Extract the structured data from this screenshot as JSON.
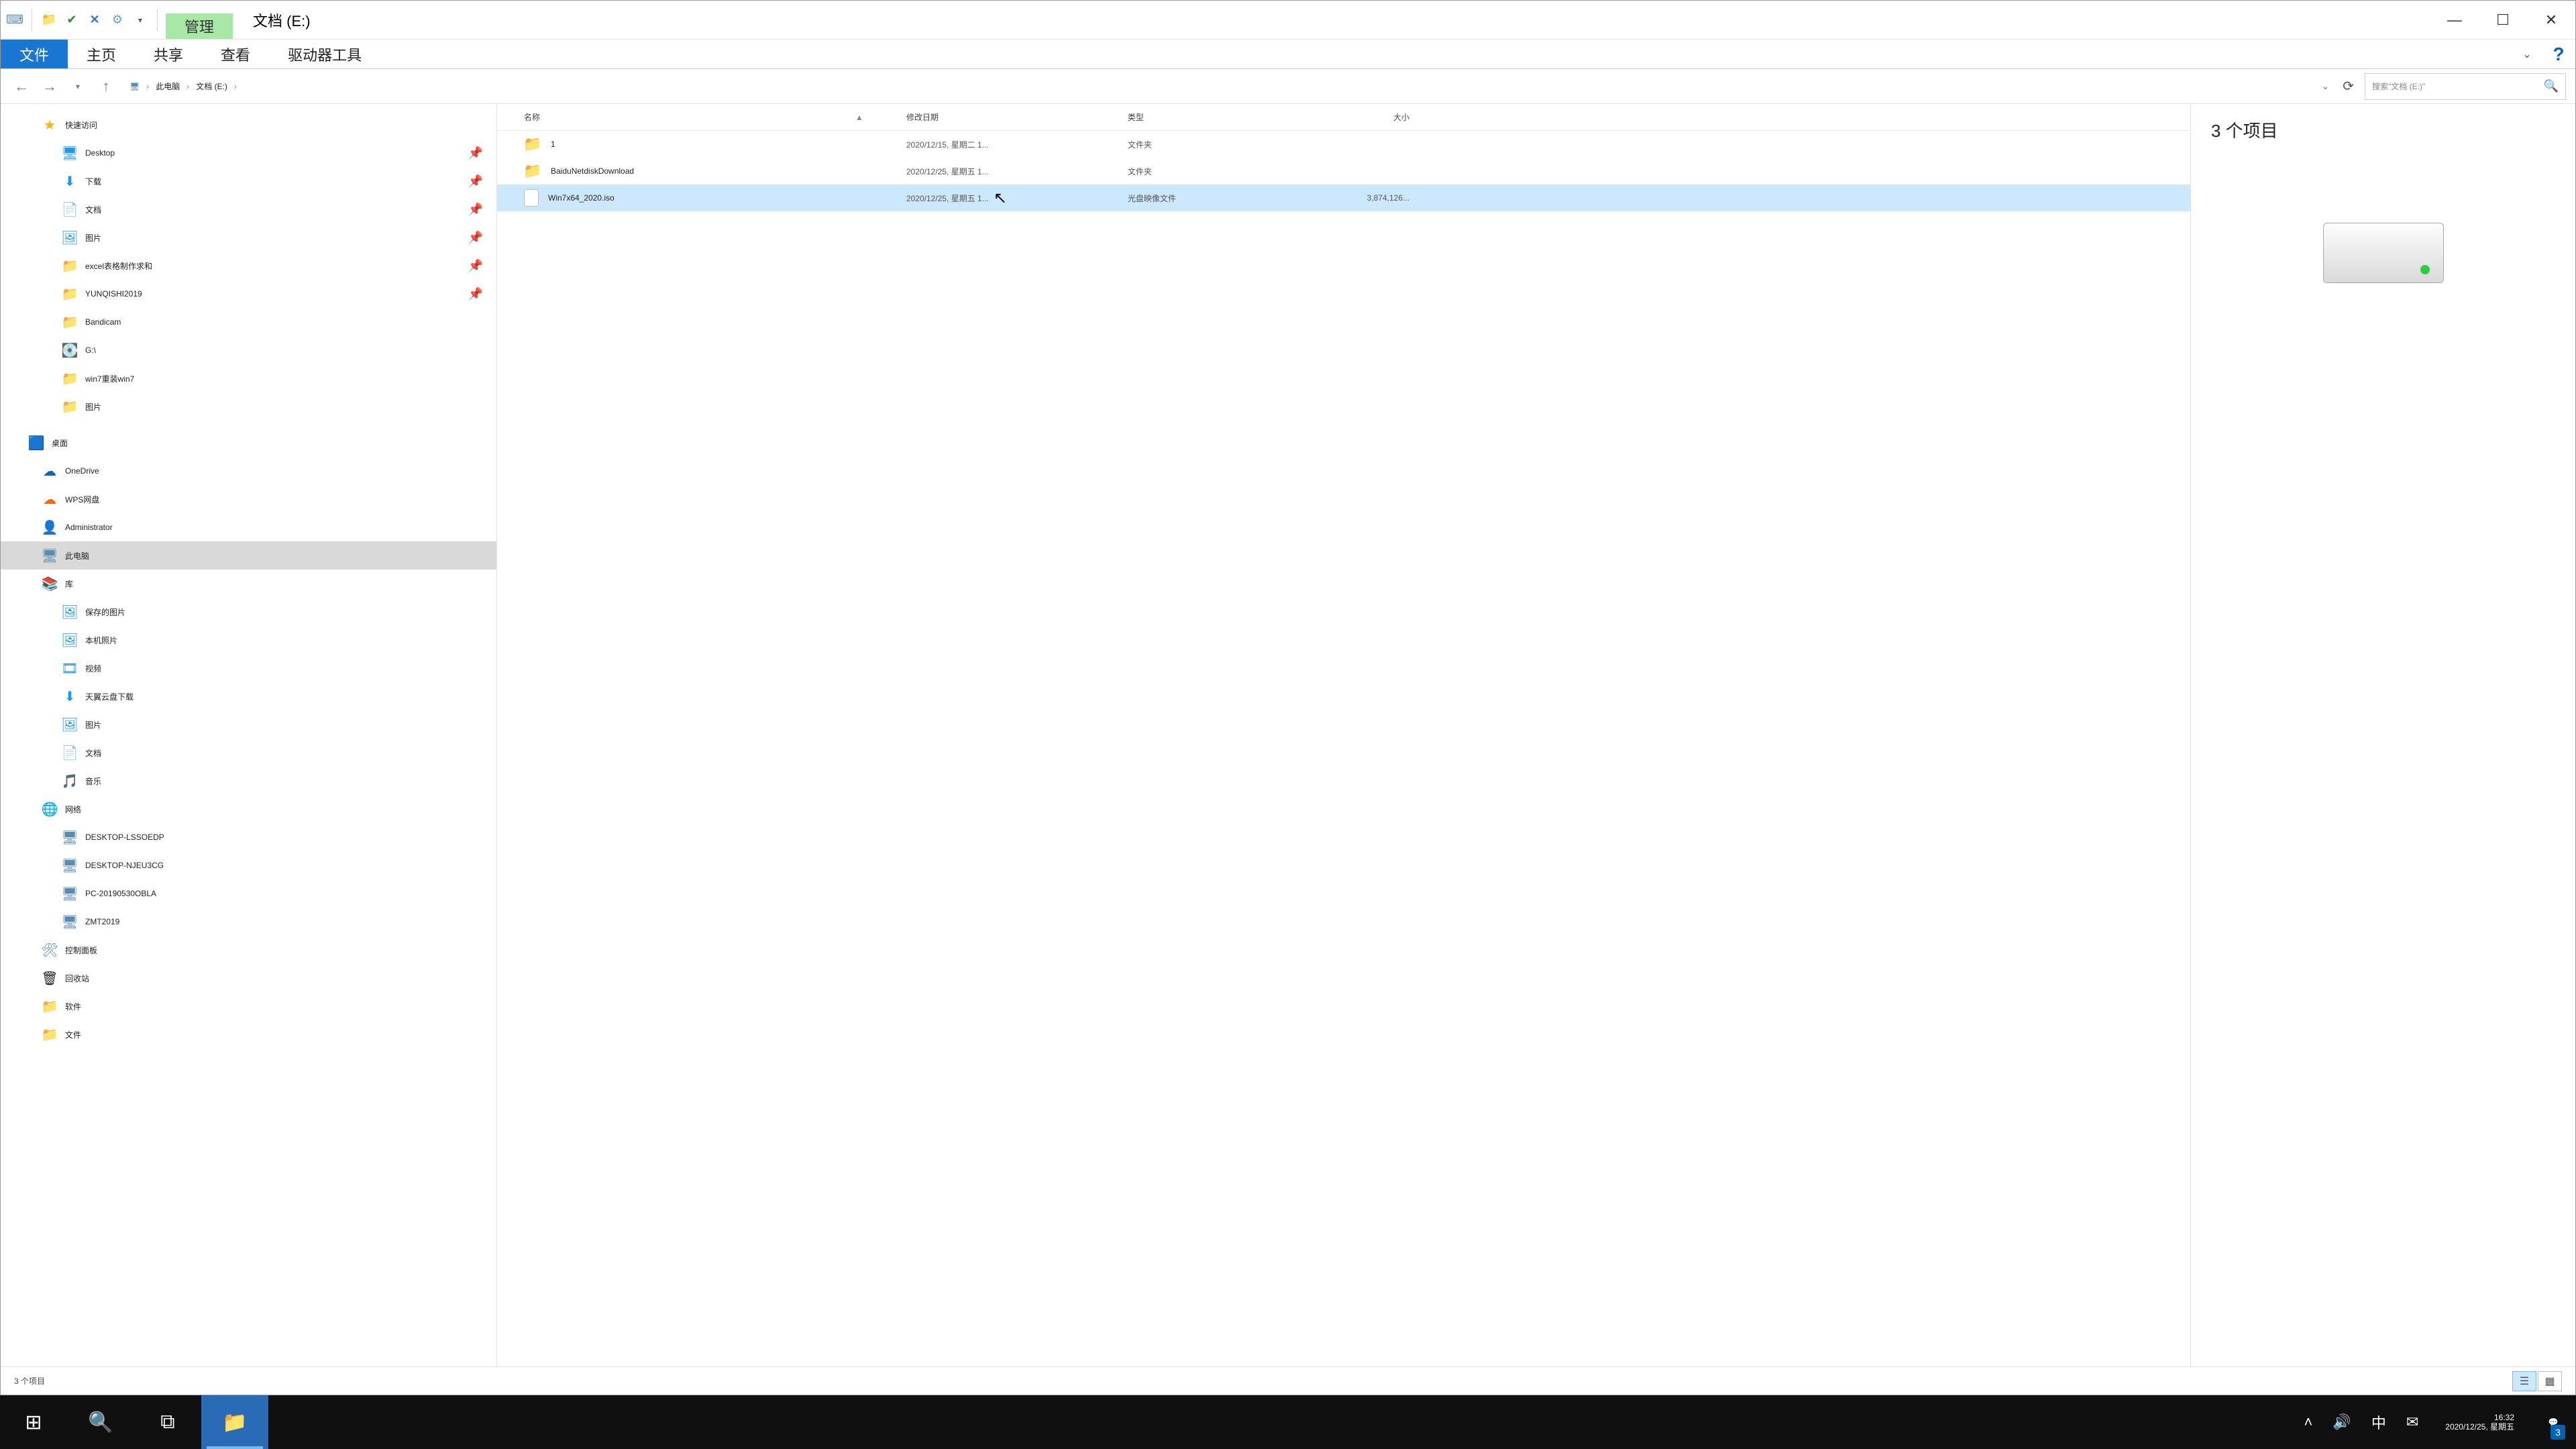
{
  "title": {
    "context_tab": "管理",
    "location": "文档 (E:)"
  },
  "ribbon": {
    "file": "文件",
    "home": "主页",
    "share": "共享",
    "view": "查看",
    "drive_tools": "驱动器工具"
  },
  "nav": {
    "back": "←",
    "forward": "→",
    "up": "↑"
  },
  "breadcrumb": {
    "root": "此电脑",
    "current": "文档 (E:)"
  },
  "search": {
    "placeholder": "搜索\"文档 (E:)\""
  },
  "tree": {
    "quick_access": "快速访问",
    "desktop": "Desktop",
    "downloads": "下载",
    "documents": "文档",
    "pictures": "图片",
    "excel": "excel表格制作求和",
    "yunqishi": "YUNQISHI2019",
    "bandicam": "Bandicam",
    "gdrive": "G:\\",
    "win7reinstall": "win7重装win7",
    "pictures2": "图片",
    "desktop_group": "桌面",
    "onedrive": "OneDrive",
    "wps": "WPS网盘",
    "admin": "Administrator",
    "this_pc": "此电脑",
    "libraries": "库",
    "saved_pics": "保存的图片",
    "camera_roll": "本机照片",
    "videos": "视频",
    "tianyi": "天翼云盘下载",
    "lib_pictures": "图片",
    "lib_documents": "文档",
    "music": "音乐",
    "network": "网络",
    "d1": "DESKTOP-LSSOEDP",
    "d2": "DESKTOP-NJEU3CG",
    "d3": "PC-20190530OBLA",
    "d4": "ZMT2019",
    "control_panel": "控制面板",
    "recycle": "回收站",
    "software": "软件",
    "files": "文件"
  },
  "columns": {
    "name": "名称",
    "date": "修改日期",
    "type": "类型",
    "size": "大小"
  },
  "rows": [
    {
      "name": "1",
      "date": "2020/12/15, 星期二 1...",
      "type": "文件夹",
      "size": "",
      "icon": "folder",
      "selected": false
    },
    {
      "name": "BaiduNetdiskDownload",
      "date": "2020/12/25, 星期五 1...",
      "type": "文件夹",
      "size": "",
      "icon": "folder",
      "selected": false
    },
    {
      "name": "Win7x64_2020.iso",
      "date": "2020/12/25, 星期五 1...",
      "type": "光盘映像文件",
      "size": "3,874,126...",
      "icon": "iso",
      "selected": true
    }
  ],
  "preview": {
    "title": "3 个项目"
  },
  "status": {
    "text": "3 个项目"
  },
  "taskbar": {
    "time": "16:32",
    "date": "2020/12/25, 星期五",
    "ime": "中",
    "notif_count": "3"
  }
}
